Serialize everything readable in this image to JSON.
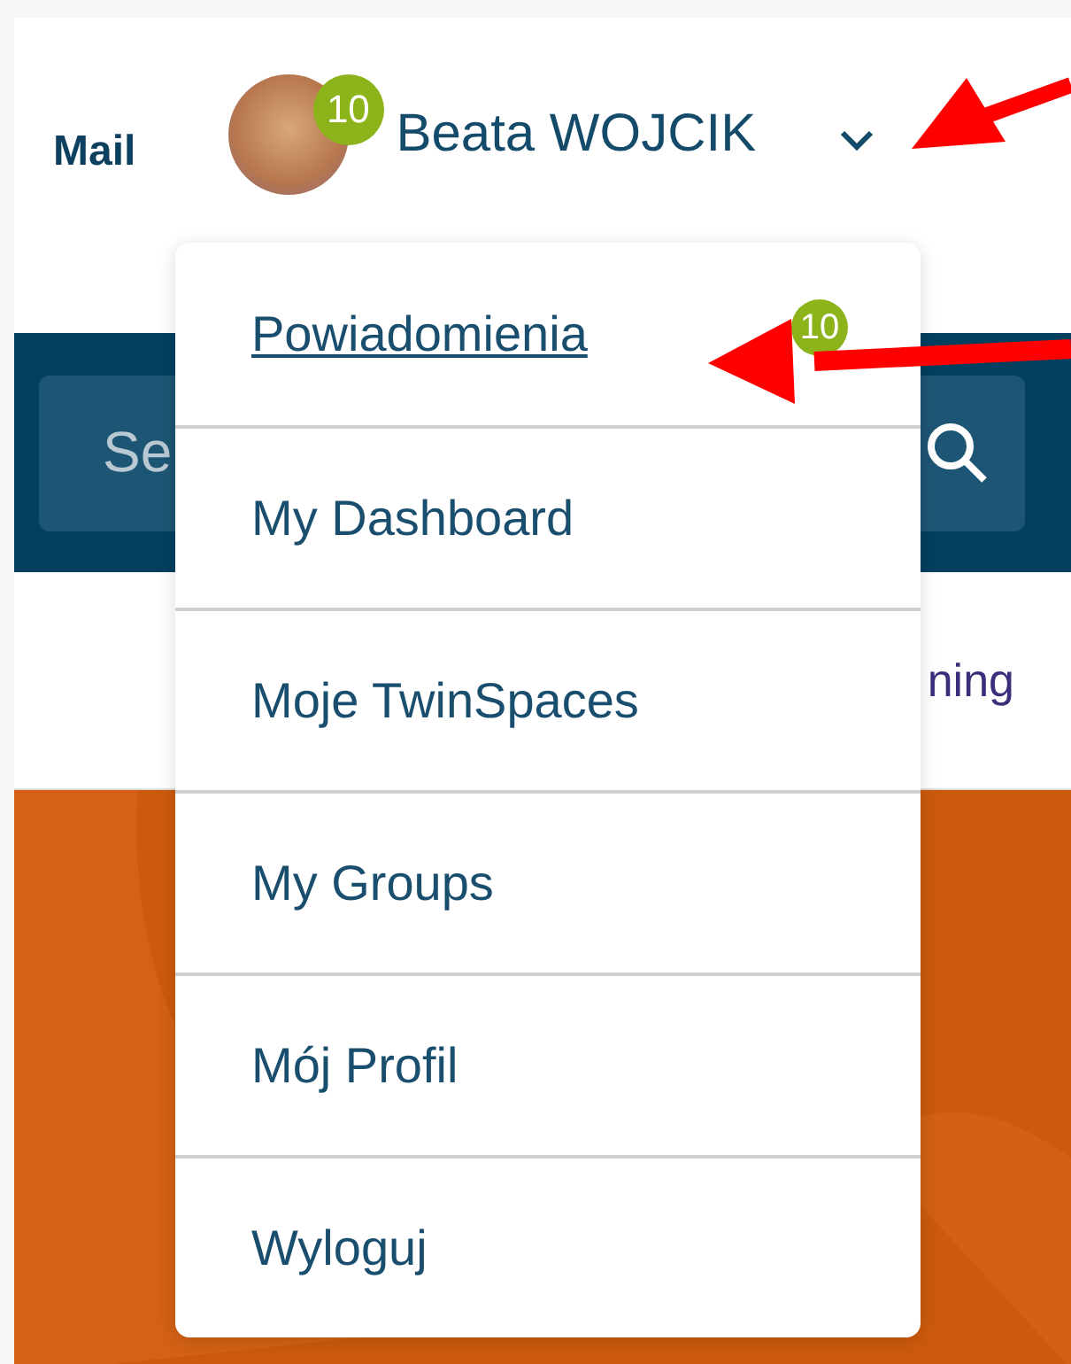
{
  "header": {
    "mail_link": "Mail",
    "user": {
      "name": "Beata WOJCIK",
      "notification_count": "10",
      "menu_expanded": true
    }
  },
  "search": {
    "placeholder": "Se"
  },
  "nav": {
    "item_text": "ning"
  },
  "user_menu": {
    "items": [
      {
        "label": "Powiadomienia",
        "selected": true,
        "badge": "10"
      },
      {
        "label": "My Dashboard",
        "selected": false
      },
      {
        "label": "Moje TwinSpaces",
        "selected": false
      },
      {
        "label": "My Groups",
        "selected": false
      },
      {
        "label": "Mój Profil",
        "selected": false
      },
      {
        "label": "Wyloguj",
        "selected": false
      }
    ]
  }
}
